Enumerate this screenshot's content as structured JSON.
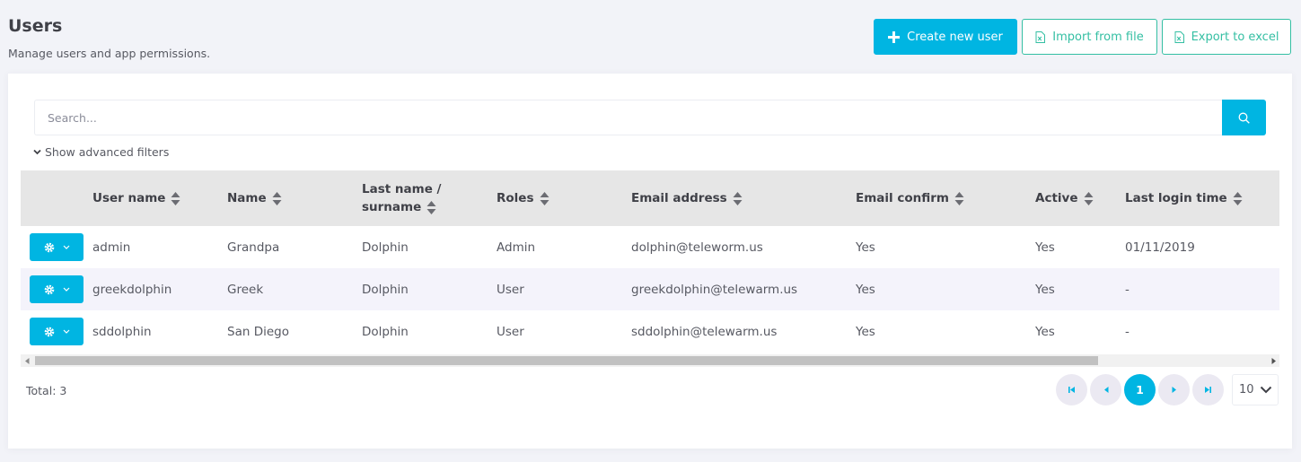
{
  "page": {
    "title": "Users",
    "subtitle": "Manage users and app permissions."
  },
  "actions": {
    "create_label": "Create new user",
    "import_label": "Import from file",
    "export_label": "Export to excel"
  },
  "search": {
    "placeholder": "Search...",
    "advanced_filters_label": "Show advanced filters"
  },
  "table": {
    "columns": [
      "User name",
      "Name",
      "Last name / surname",
      "Roles",
      "Email address",
      "Email confirm",
      "Active",
      "Last login time"
    ],
    "column_lines": {
      "lastname_line1": "Last name /",
      "lastname_line2": "surname"
    },
    "rows": [
      {
        "username": "admin",
        "name": "Grandpa",
        "surname": "Dolphin",
        "roles": "Admin",
        "email": "dolphin@teleworm.us",
        "email_confirm": "Yes",
        "active": "Yes",
        "last_login": "01/11/2019"
      },
      {
        "username": "greekdolphin",
        "name": "Greek",
        "surname": "Dolphin",
        "roles": "User",
        "email": "greekdolphin@telewarm.us",
        "email_confirm": "Yes",
        "active": "Yes",
        "last_login": "-"
      },
      {
        "username": "sddolphin",
        "name": "San Diego",
        "surname": "Dolphin",
        "roles": "User",
        "email": "sddolphin@telewarm.us",
        "email_confirm": "Yes",
        "active": "Yes",
        "last_login": "-"
      }
    ]
  },
  "footer": {
    "total_label": "Total: 3",
    "current_page": "1",
    "page_size": "10"
  },
  "colors": {
    "primary": "#00b5e2",
    "success_outline": "#34bfa3",
    "header_bg": "#e6e6e6",
    "stripe_bg": "#f4f3fb"
  },
  "icons": {
    "create": "plus-icon",
    "import": "excel-file-icon",
    "export": "excel-file-icon",
    "search": "search-icon",
    "filters": "chevron-down-icon",
    "row_action": "gear-icon",
    "sort": "sort-icon",
    "first_page": "first-page-icon",
    "prev_page": "prev-page-icon",
    "next_page": "next-page-icon",
    "last_page": "last-page-icon"
  }
}
